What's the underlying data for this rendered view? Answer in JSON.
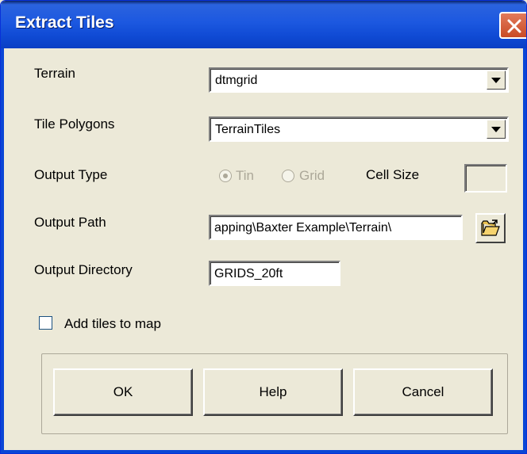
{
  "window": {
    "title": "Extract Tiles"
  },
  "terrain": {
    "label": "Terrain",
    "value": "dtmgrid"
  },
  "tile_polygons": {
    "label": "Tile Polygons",
    "value": "TerrainTiles"
  },
  "output_type": {
    "label": "Output Type",
    "options": [
      {
        "label": "Tin",
        "selected": true
      },
      {
        "label": "Grid",
        "selected": false
      }
    ],
    "cell_size_label": "Cell Size",
    "cell_size_value": ""
  },
  "output_path": {
    "label": "Output Path",
    "value": "apping\\Baxter Example\\Terrain\\"
  },
  "output_directory": {
    "label": "Output Directory",
    "value": "GRIDS_20ft"
  },
  "add_tiles": {
    "label": "Add tiles to map",
    "checked": false
  },
  "buttons": {
    "ok": "OK",
    "help": "Help",
    "cancel": "Cancel"
  },
  "icons": {
    "close": "close-icon",
    "dropdown": "chevron-down-icon",
    "browse": "folder-open-icon"
  },
  "colors": {
    "titlebar": "#0a46d6",
    "close_button": "#d95b38",
    "dialog_bg": "#ece9d8"
  }
}
